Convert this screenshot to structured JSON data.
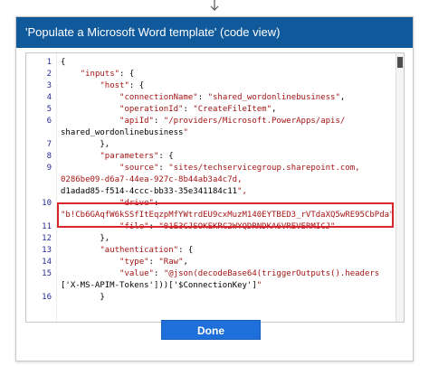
{
  "dialog": {
    "title": "'Populate a Microsoft Word template' (code view)",
    "done_label": "Done"
  },
  "editor": {
    "lines": [
      {
        "n": "1",
        "t": "{"
      },
      {
        "n": "2",
        "t": "    \"inputs\": {"
      },
      {
        "n": "3",
        "t": "        \"host\": {"
      },
      {
        "n": "4",
        "t": "            \"connectionName\": \"shared_wordonlinebusiness\","
      },
      {
        "n": "5",
        "t": "            \"operationId\": \"CreateFileItem\","
      },
      {
        "n": "6",
        "t": "            \"apiId\": \"/providers/Microsoft.PowerApps/apis/"
      },
      {
        "n": "",
        "t": "shared_wordonlinebusiness\""
      },
      {
        "n": "7",
        "t": "        },"
      },
      {
        "n": "8",
        "t": "        \"parameters\": {"
      },
      {
        "n": "9",
        "t": "            \"source\": \"sites/techservicegroup.sharepoint.com,"
      },
      {
        "n": "",
        "t": "0286be09-d6a7-44ea-927c-8b44ab3a4c7d,"
      },
      {
        "n": "",
        "t": "d1adad85-f514-4ccc-bb33-35e341184c11\","
      },
      {
        "n": "10",
        "t": "            \"drive\":"
      },
      {
        "n": "",
        "t": "\"b!Cb6GAqfW6kSSfItEqzpMfYWtrdEU9cxMuzM140EYTBED3_rVTdaXQ5wRE95CbPda\","
      },
      {
        "n": "11",
        "t": "            \"file\": \"01E3CJSOKEKRC2WYQDRNDKA6VREVERMICJ\""
      },
      {
        "n": "12",
        "t": "        },"
      },
      {
        "n": "13",
        "t": "        \"authentication\": {"
      },
      {
        "n": "14",
        "t": "            \"type\": \"Raw\","
      },
      {
        "n": "15",
        "t": "            \"value\": \"@json(decodeBase64(triggerOutputs().headers"
      },
      {
        "n": "",
        "t": "['X-MS-APIM-Tokens']))['$ConnectionKey']\""
      },
      {
        "n": "16",
        "t": "        }"
      }
    ]
  },
  "colors": {
    "header_bg": "#105a9c",
    "button_bg": "#1e6fd9",
    "highlight_border": "#d9262e",
    "string_color": "#a31515",
    "line_number_color": "#2b2b99"
  },
  "icons": {
    "top_connector": "arrow-down-icon",
    "scroll_thumb": "scrollbar-thumb"
  }
}
